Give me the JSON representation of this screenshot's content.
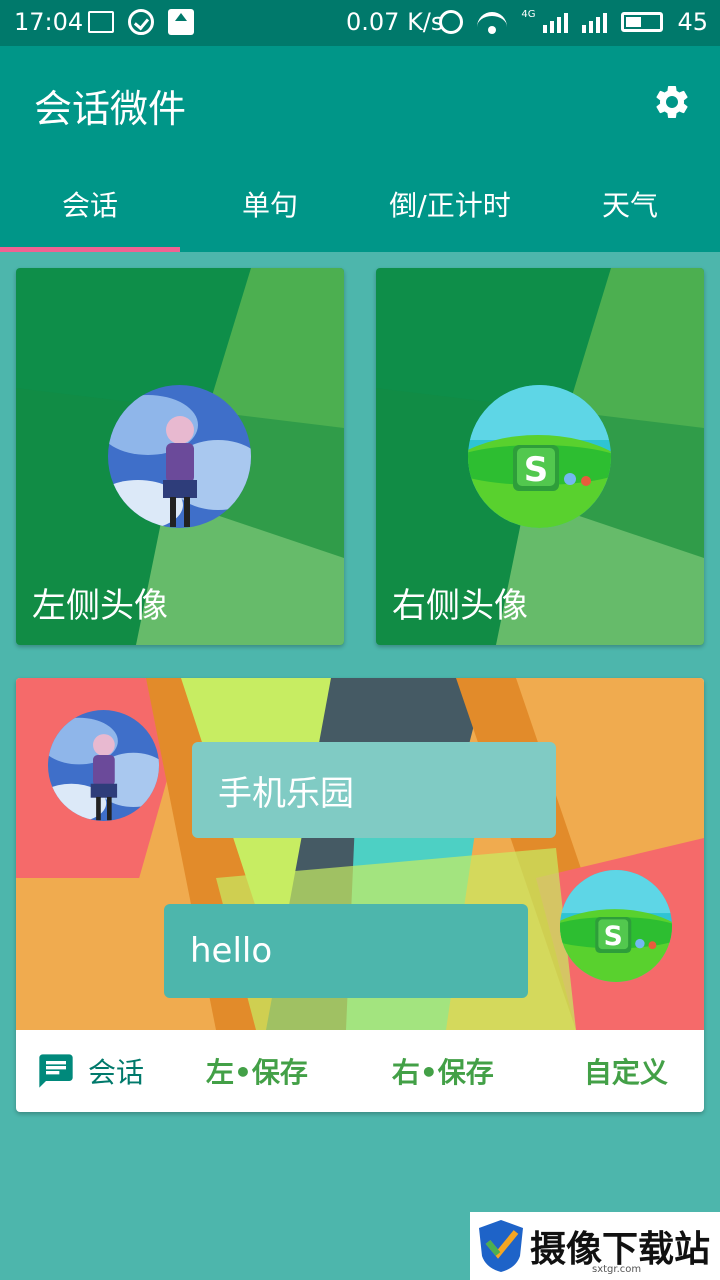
{
  "status_bar": {
    "time": "17:04",
    "speed": "0.07 K/s",
    "network": "4G",
    "battery": "45"
  },
  "app": {
    "title": "会话微件",
    "settings_icon": "gear-icon"
  },
  "tabs": [
    {
      "label": "会话",
      "active": true
    },
    {
      "label": "单句",
      "active": false
    },
    {
      "label": "倒/正计时",
      "active": false
    },
    {
      "label": "天气",
      "active": false
    }
  ],
  "avatar_cards": {
    "left_label": "左侧头像",
    "right_label": "右侧头像"
  },
  "preview": {
    "message_1": "手机乐园",
    "message_2": "hello"
  },
  "actions": {
    "type_label": "会话",
    "type_icon": "chat-icon",
    "left_save": "左•保存",
    "right_save": "右•保存",
    "custom": "自定义"
  },
  "watermark": {
    "text": "摄像下载站",
    "sub": "sxtgr.com"
  },
  "colors": {
    "primary": "#009688",
    "primary_dark": "#00796B",
    "background": "#4DB6AC",
    "accent": "#F06292",
    "action_green": "#43A047"
  }
}
